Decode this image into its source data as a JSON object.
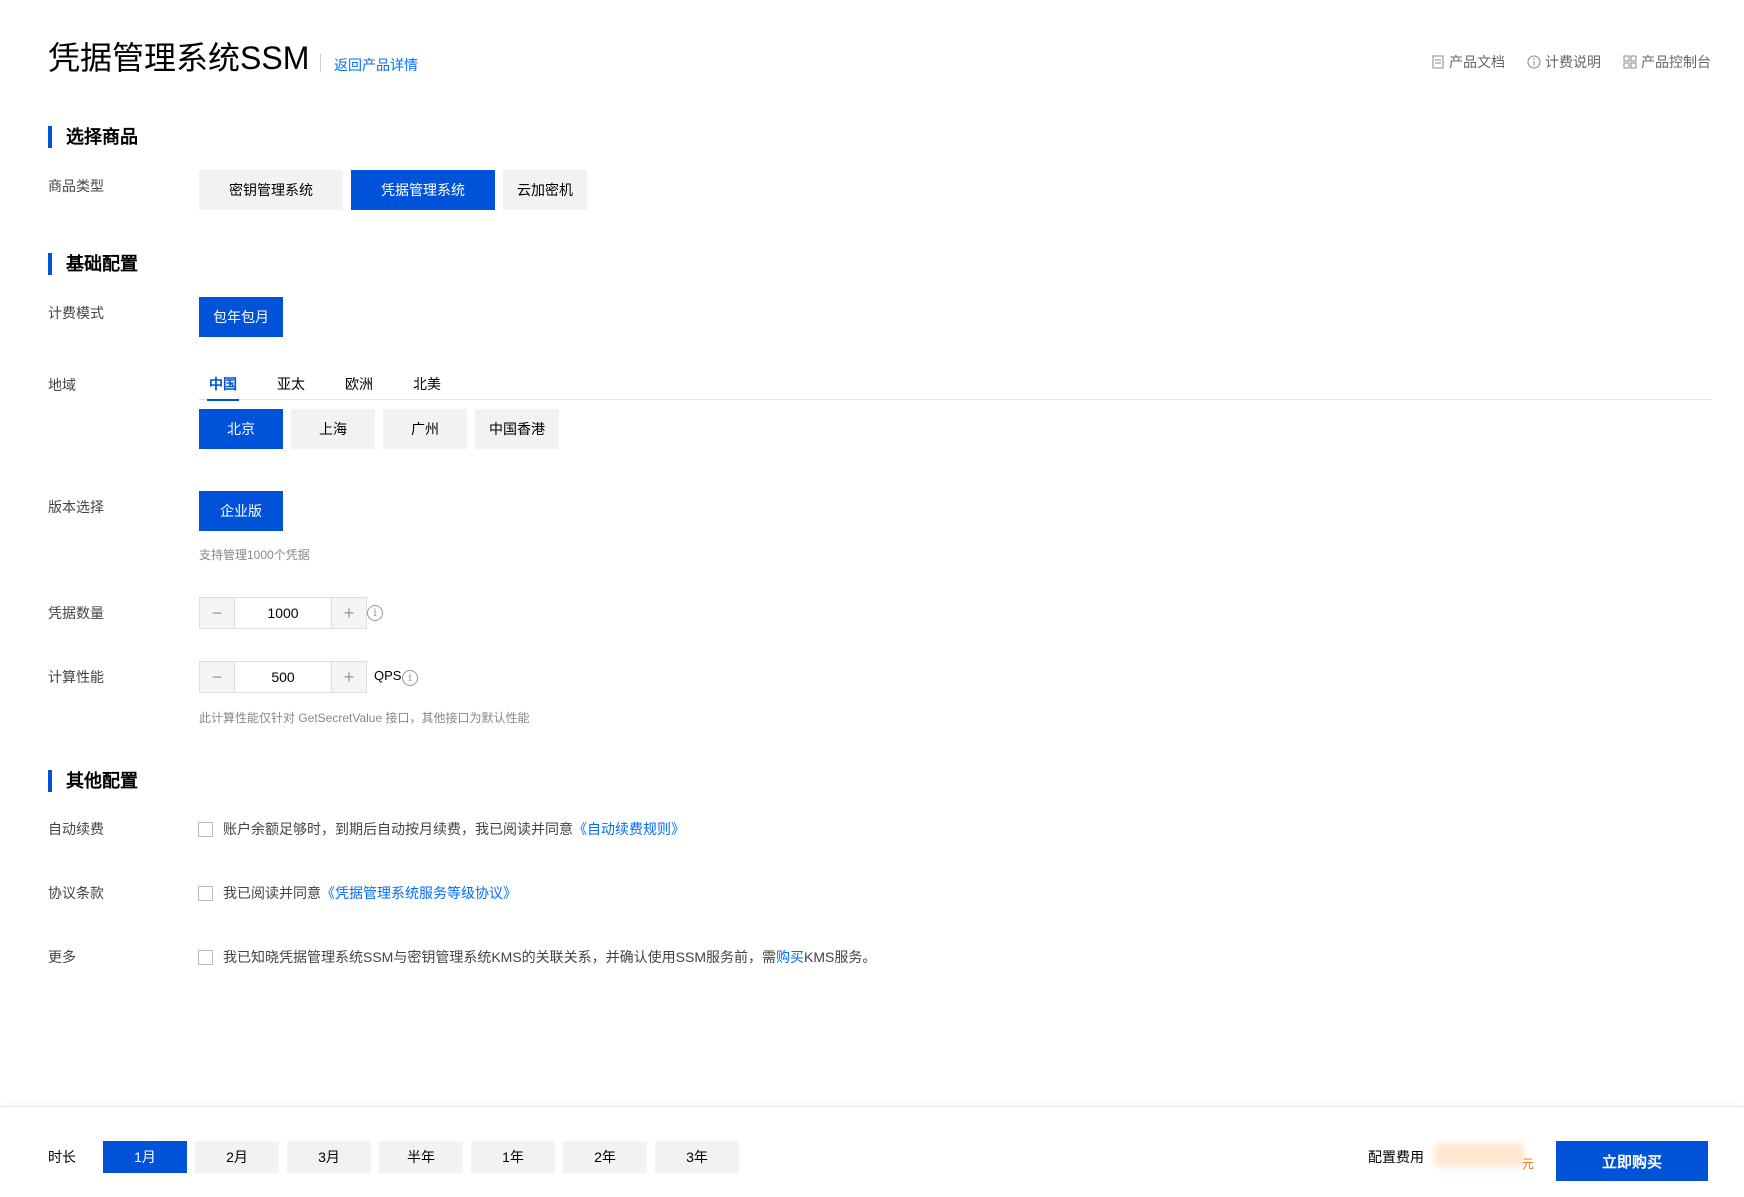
{
  "header": {
    "title": "凭据管理系统SSM",
    "back_link": "返回产品详情",
    "links": [
      {
        "label": "产品文档",
        "icon": "document-icon"
      },
      {
        "label": "计费说明",
        "icon": "info-icon"
      },
      {
        "label": "产品控制台",
        "icon": "grid-icon"
      }
    ]
  },
  "section_product": {
    "title": "选择商品",
    "type_label": "商品类型",
    "types": [
      "密钥管理系统",
      "凭据管理系统",
      "云加密机"
    ],
    "selected_type": "凭据管理系统"
  },
  "section_basic": {
    "title": "基础配置",
    "billing_label": "计费模式",
    "billing_options": [
      "包年包月"
    ],
    "region_label": "地域",
    "region_tabs": [
      "中国",
      "亚太",
      "欧洲",
      "北美"
    ],
    "active_region_tab": "中国",
    "cities": [
      "北京",
      "上海",
      "广州",
      "中国香港"
    ],
    "selected_city": "北京",
    "edition_label": "版本选择",
    "editions": [
      "企业版"
    ],
    "edition_hint": "支持管理1000个凭据",
    "credential_count_label": "凭据数量",
    "credential_count": "1000",
    "performance_label": "计算性能",
    "performance": "500",
    "performance_unit": "QPS",
    "performance_hint": "此计算性能仅针对 GetSecretValue 接口，其他接口为默认性能"
  },
  "section_other": {
    "title": "其他配置",
    "auto_renew_label": "自动续费",
    "auto_renew_text": "账户余额足够时，到期后自动按月续费，我已阅读并同意",
    "auto_renew_link": "《自动续费规则》",
    "agreement_label": "协议条款",
    "agreement_text": "我已阅读并同意",
    "agreement_link": "《凭据管理系统服务等级协议》",
    "more_label": "更多",
    "more_text_before": "我已知晓凭据管理系统SSM与密钥管理系统KMS的关联关系，并确认使用SSM服务前，需",
    "more_link": "购买",
    "more_text_after": "KMS服务。"
  },
  "footer": {
    "duration_label": "时长",
    "durations": [
      "1月",
      "2月",
      "3月",
      "半年",
      "1年",
      "2年",
      "3年"
    ],
    "selected_duration": "1月",
    "cost_label": "配置费用",
    "cost_unit": "元",
    "buy_label": "立即购买"
  },
  "colors": {
    "primary": "#0052d9",
    "link": "#006eff",
    "price": "#ff7200"
  }
}
